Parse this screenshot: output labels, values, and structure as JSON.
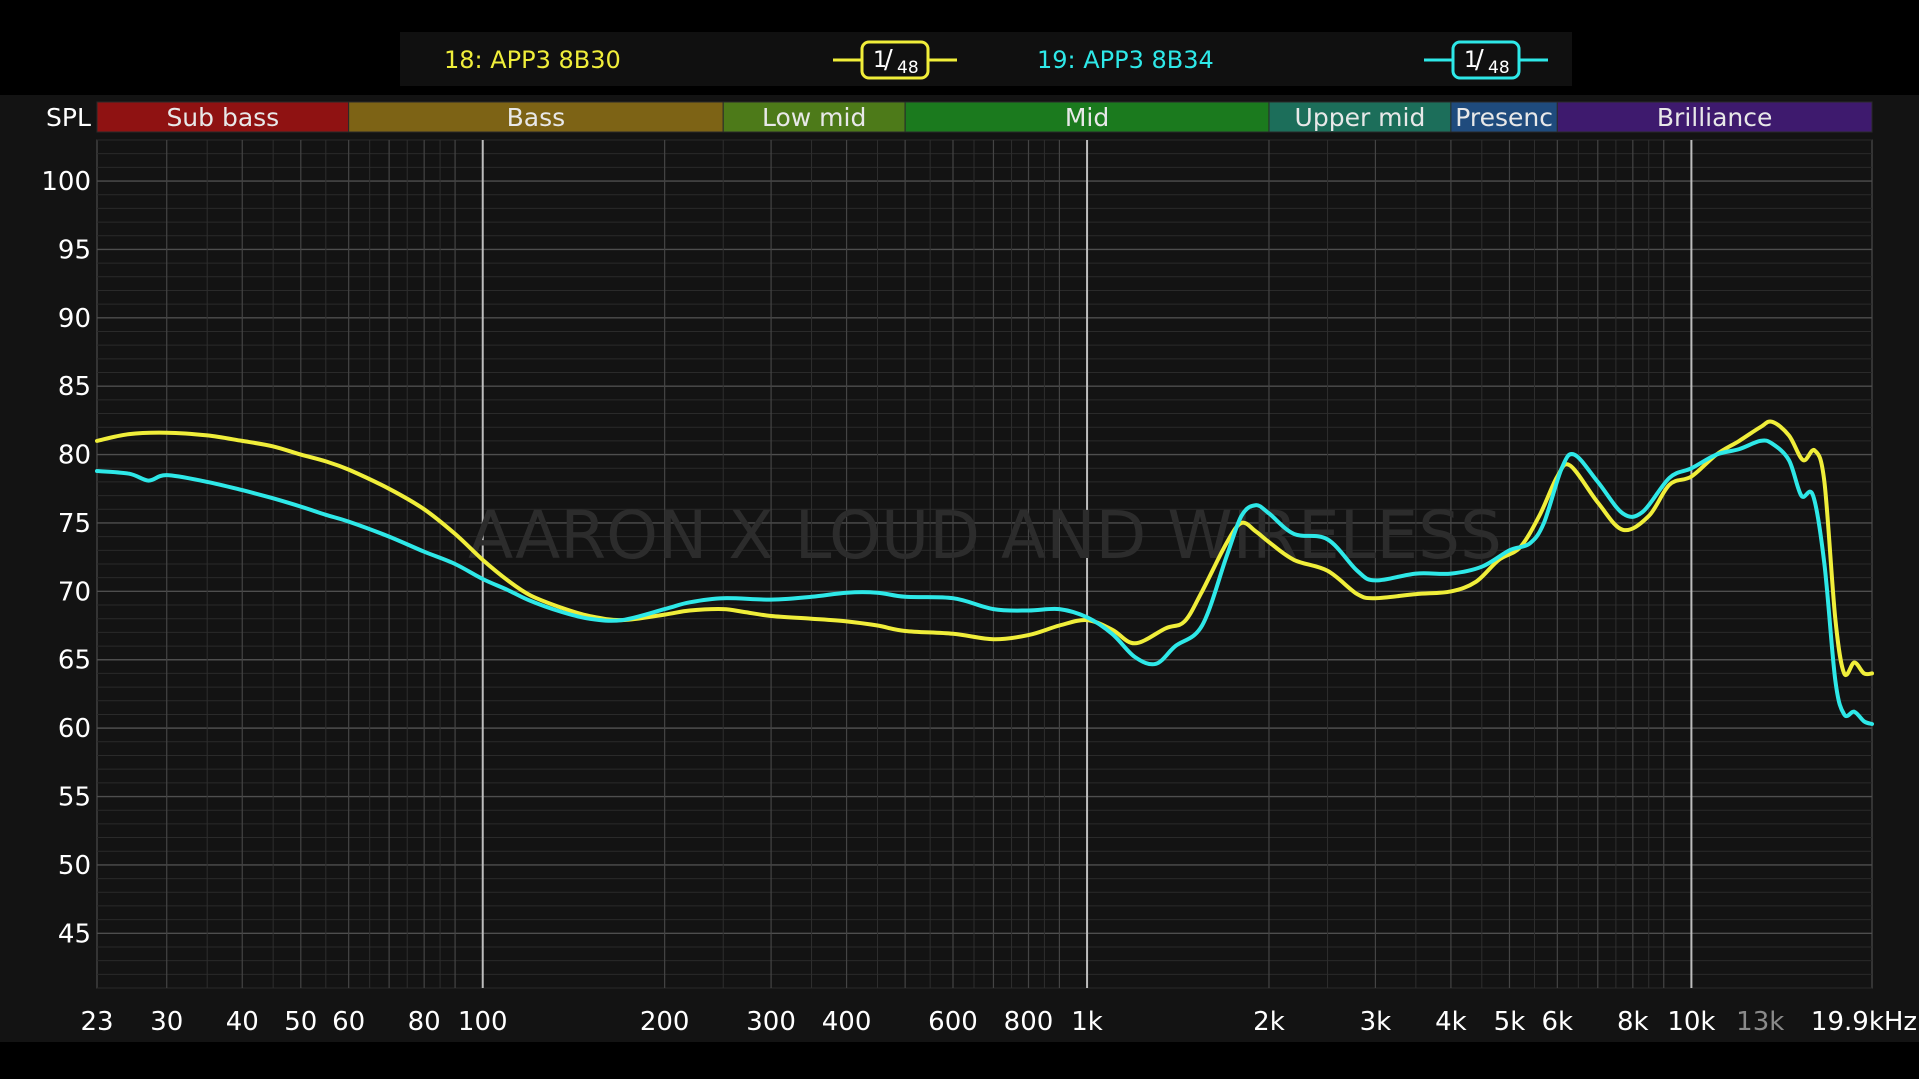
{
  "chart_data": {
    "type": "line",
    "xscale": "log",
    "xlim": [
      23,
      19900
    ],
    "ylim": [
      41,
      103
    ],
    "ylabel": "SPL",
    "grid": true,
    "watermark": "AARON X LOUD AND WIRELESS",
    "y_ticks": [
      100,
      95,
      90,
      85,
      80,
      75,
      70,
      65,
      60,
      55,
      50,
      45
    ],
    "x_ticks": [
      {
        "v": 23,
        "label": "23"
      },
      {
        "v": 30,
        "label": "30"
      },
      {
        "v": 40,
        "label": "40"
      },
      {
        "v": 50,
        "label": "50"
      },
      {
        "v": 60,
        "label": "60"
      },
      {
        "v": 80,
        "label": "80"
      },
      {
        "v": 100,
        "label": "100"
      },
      {
        "v": 200,
        "label": "200"
      },
      {
        "v": 300,
        "label": "300"
      },
      {
        "v": 400,
        "label": "400"
      },
      {
        "v": 600,
        "label": "600"
      },
      {
        "v": 800,
        "label": "800"
      },
      {
        "v": 1000,
        "label": "1k"
      },
      {
        "v": 2000,
        "label": "2k"
      },
      {
        "v": 3000,
        "label": "3k"
      },
      {
        "v": 4000,
        "label": "4k"
      },
      {
        "v": 5000,
        "label": "5k"
      },
      {
        "v": 6000,
        "label": "6k"
      },
      {
        "v": 8000,
        "label": "8k"
      },
      {
        "v": 10000,
        "label": "10k"
      },
      {
        "v": 13000,
        "label": "13k",
        "dim": true
      },
      {
        "v": 19900,
        "label": "19.9kHz"
      }
    ],
    "bands": [
      {
        "name": "Sub bass",
        "from": 23,
        "to": 60,
        "color": "#8f1212"
      },
      {
        "name": "Bass",
        "from": 60,
        "to": 250,
        "color": "#7d6315"
      },
      {
        "name": "Low mid",
        "from": 250,
        "to": 500,
        "color": "#4d7a19"
      },
      {
        "name": "Mid",
        "from": 500,
        "to": 2000,
        "color": "#1b7a1e"
      },
      {
        "name": "Upper mid",
        "from": 2000,
        "to": 4000,
        "color": "#1c6e5a"
      },
      {
        "name": "Presenc",
        "from": 4000,
        "to": 6000,
        "color": "#1f4b7d"
      },
      {
        "name": "Brilliance",
        "from": 6000,
        "to": 19900,
        "color": "#3e1a6e"
      }
    ],
    "series": [
      {
        "name": "18: APP3 8B30",
        "smoothing": "1/48",
        "color": "#f0ee3a",
        "points": [
          [
            23,
            81
          ],
          [
            26,
            81.5
          ],
          [
            30,
            81.6
          ],
          [
            35,
            81.4
          ],
          [
            40,
            81
          ],
          [
            45,
            80.6
          ],
          [
            50,
            80
          ],
          [
            55,
            79.5
          ],
          [
            60,
            78.9
          ],
          [
            70,
            77.5
          ],
          [
            80,
            76
          ],
          [
            90,
            74.2
          ],
          [
            100,
            72.3
          ],
          [
            110,
            70.8
          ],
          [
            120,
            69.7
          ],
          [
            135,
            68.8
          ],
          [
            150,
            68.2
          ],
          [
            170,
            67.9
          ],
          [
            200,
            68.3
          ],
          [
            220,
            68.6
          ],
          [
            250,
            68.7
          ],
          [
            270,
            68.5
          ],
          [
            300,
            68.2
          ],
          [
            350,
            68
          ],
          [
            400,
            67.8
          ],
          [
            450,
            67.5
          ],
          [
            500,
            67.1
          ],
          [
            600,
            66.9
          ],
          [
            700,
            66.5
          ],
          [
            800,
            66.8
          ],
          [
            900,
            67.5
          ],
          [
            1000,
            67.9
          ],
          [
            1100,
            67.2
          ],
          [
            1200,
            66.2
          ],
          [
            1350,
            67.3
          ],
          [
            1450,
            67.8
          ],
          [
            1550,
            70
          ],
          [
            1700,
            73.5
          ],
          [
            1800,
            75
          ],
          [
            1900,
            74.4
          ],
          [
            2000,
            73.6
          ],
          [
            2200,
            72.3
          ],
          [
            2500,
            71.5
          ],
          [
            2800,
            69.8
          ],
          [
            3000,
            69.5
          ],
          [
            3500,
            69.8
          ],
          [
            4000,
            70
          ],
          [
            4400,
            70.7
          ],
          [
            4800,
            72.3
          ],
          [
            5200,
            73.2
          ],
          [
            5600,
            75.5
          ],
          [
            6000,
            78.4
          ],
          [
            6300,
            79.2
          ],
          [
            7000,
            76.5
          ],
          [
            7700,
            74.5
          ],
          [
            8500,
            75.5
          ],
          [
            9200,
            77.8
          ],
          [
            10000,
            78.4
          ],
          [
            11000,
            80
          ],
          [
            12000,
            81
          ],
          [
            13000,
            82
          ],
          [
            13600,
            82.4
          ],
          [
            14500,
            81.4
          ],
          [
            15300,
            79.6
          ],
          [
            16000,
            80.3
          ],
          [
            16600,
            78
          ],
          [
            17300,
            68
          ],
          [
            17900,
            64
          ],
          [
            18600,
            64.8
          ],
          [
            19300,
            64
          ],
          [
            19900,
            64
          ]
        ]
      },
      {
        "name": "19: APP3 8B34",
        "smoothing": "1/48",
        "color": "#2ee8e8",
        "points": [
          [
            23,
            78.8
          ],
          [
            26,
            78.6
          ],
          [
            28,
            78.1
          ],
          [
            30,
            78.5
          ],
          [
            35,
            78
          ],
          [
            40,
            77.4
          ],
          [
            45,
            76.8
          ],
          [
            50,
            76.2
          ],
          [
            55,
            75.6
          ],
          [
            60,
            75.1
          ],
          [
            70,
            74
          ],
          [
            80,
            72.9
          ],
          [
            90,
            72
          ],
          [
            100,
            70.9
          ],
          [
            110,
            70.1
          ],
          [
            120,
            69.3
          ],
          [
            135,
            68.5
          ],
          [
            150,
            68
          ],
          [
            170,
            67.9
          ],
          [
            200,
            68.7
          ],
          [
            220,
            69.2
          ],
          [
            250,
            69.5
          ],
          [
            300,
            69.4
          ],
          [
            350,
            69.6
          ],
          [
            400,
            69.9
          ],
          [
            450,
            69.9
          ],
          [
            500,
            69.6
          ],
          [
            600,
            69.5
          ],
          [
            700,
            68.7
          ],
          [
            800,
            68.6
          ],
          [
            900,
            68.7
          ],
          [
            1000,
            68.1
          ],
          [
            1100,
            66.9
          ],
          [
            1200,
            65.2
          ],
          [
            1300,
            64.7
          ],
          [
            1400,
            66
          ],
          [
            1550,
            67.5
          ],
          [
            1700,
            72.5
          ],
          [
            1800,
            75.5
          ],
          [
            1900,
            76.3
          ],
          [
            2000,
            75.7
          ],
          [
            2200,
            74.2
          ],
          [
            2500,
            73.8
          ],
          [
            2800,
            71.5
          ],
          [
            3000,
            70.8
          ],
          [
            3500,
            71.3
          ],
          [
            4000,
            71.3
          ],
          [
            4500,
            71.8
          ],
          [
            5000,
            73
          ],
          [
            5400,
            73.5
          ],
          [
            5700,
            75
          ],
          [
            6100,
            79
          ],
          [
            6400,
            80
          ],
          [
            7000,
            78
          ],
          [
            7700,
            75.7
          ],
          [
            8300,
            75.8
          ],
          [
            9200,
            78.3
          ],
          [
            10000,
            79
          ],
          [
            11000,
            80
          ],
          [
            12000,
            80.4
          ],
          [
            13000,
            81
          ],
          [
            13600,
            80.8
          ],
          [
            14500,
            79.6
          ],
          [
            15200,
            77
          ],
          [
            15900,
            77
          ],
          [
            16600,
            72
          ],
          [
            17300,
            63.5
          ],
          [
            17900,
            61
          ],
          [
            18600,
            61.2
          ],
          [
            19300,
            60.5
          ],
          [
            19900,
            60.3
          ]
        ]
      }
    ]
  }
}
